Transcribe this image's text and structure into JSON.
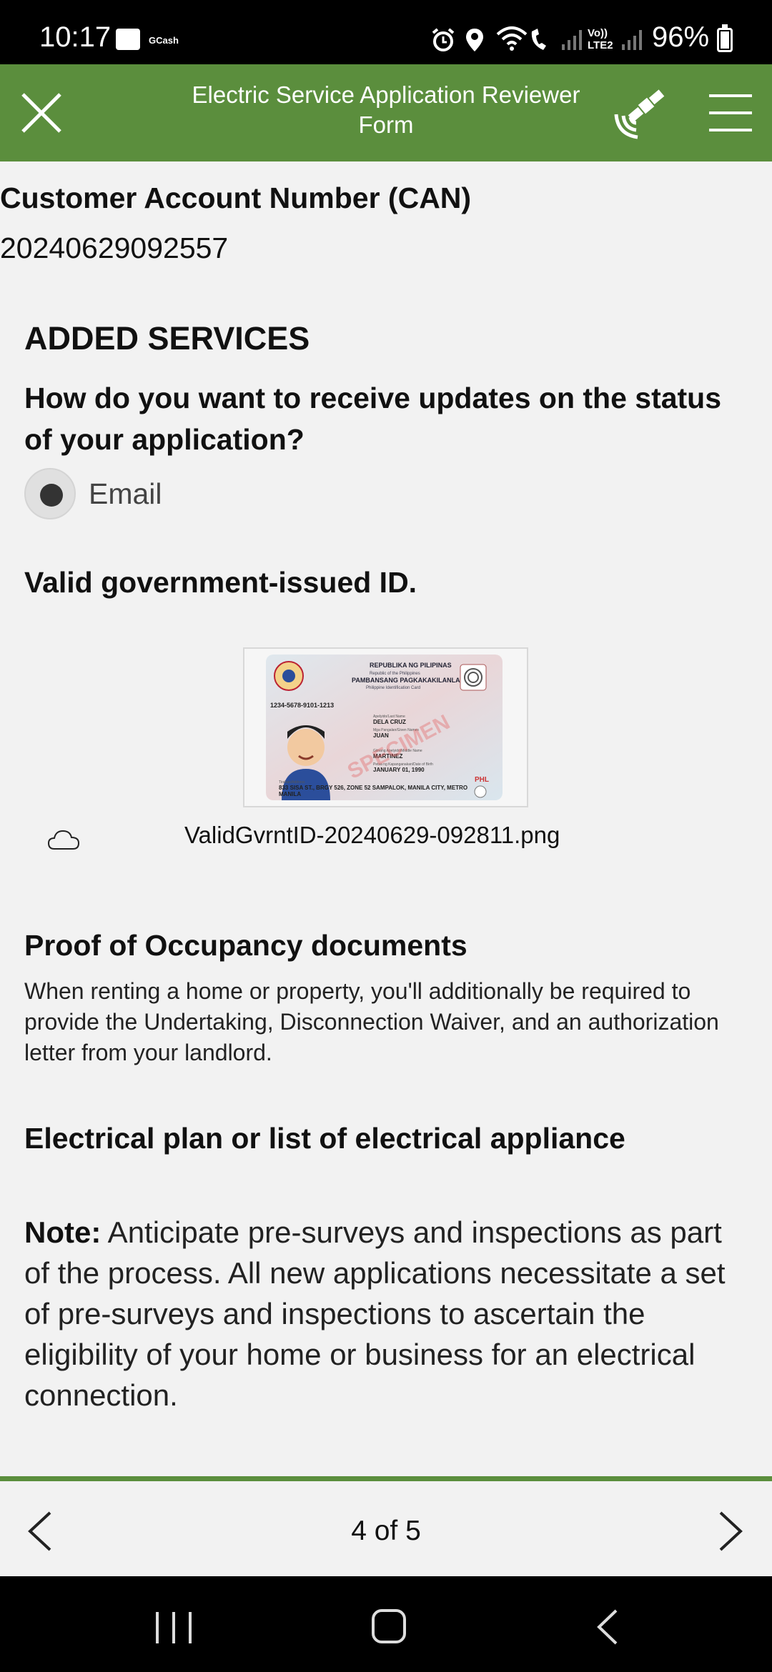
{
  "status_bar": {
    "time": "10:17",
    "app_label": "GCash",
    "battery": "96%",
    "network_label": "Vo)) LTE2"
  },
  "header": {
    "title": "Electric Service Application Reviewer Form",
    "close_icon": "close-icon",
    "satellite_icon": "satellite-icon",
    "menu_icon": "hamburger-menu-icon",
    "color": "#5b8e3d"
  },
  "account": {
    "label": "Customer Account Number (CAN)",
    "value": "20240629092557"
  },
  "added_services": {
    "heading": "ADDED SERVICES",
    "question": "How do you want to receive updates on the status of your application?",
    "selected_option": "Email"
  },
  "valid_id": {
    "heading": "Valid government-issued ID.",
    "filename": "ValidGvrntID-20240629-092811.png",
    "card": {
      "country": "REPUBLIKA NG PILIPINAS",
      "country_en": "Republic of the Philippines",
      "agency": "PAMBANSANG PAGKAKAKILANLAN",
      "card_type": "Philippine Identification Card",
      "number": "1234-5678-9101-1213",
      "last_name_label": "Apelyido/Last Name",
      "last_name": "DELA CRUZ",
      "given_names_label": "Mga Pangalan/Given Names",
      "given_names": "JUAN",
      "middle_name_label": "Gitnang Apelyido/Middle Name",
      "middle_name": "MARTINEZ",
      "dob_label": "Petsa ng Kapanganakan/Date of Birth",
      "dob": "JANUARY 01, 1990",
      "address_label": "Tirahan/Address",
      "address": "833 SISA ST., BRGY 526, ZONE 52 SAMPALOK, MANILA CITY, METRO MANILA",
      "country_code": "PHL",
      "watermark": "SPECIMEN"
    }
  },
  "occupancy": {
    "heading": "Proof of Occupancy documents",
    "text": "When renting a home or property, you'll additionally be required to provide the Undertaking, Disconnection Waiver, and an authorization letter from your landlord."
  },
  "electrical": {
    "heading": "Electrical plan or list of electrical appliance"
  },
  "note": {
    "label": "Note:",
    "text": " Anticipate pre-surveys and inspections as part of the process. All new applications necessitate a set of pre-surveys and inspections to ascertain the eligibility of your home or business for an electrical connection."
  },
  "pager": {
    "text": "4 of 5"
  }
}
